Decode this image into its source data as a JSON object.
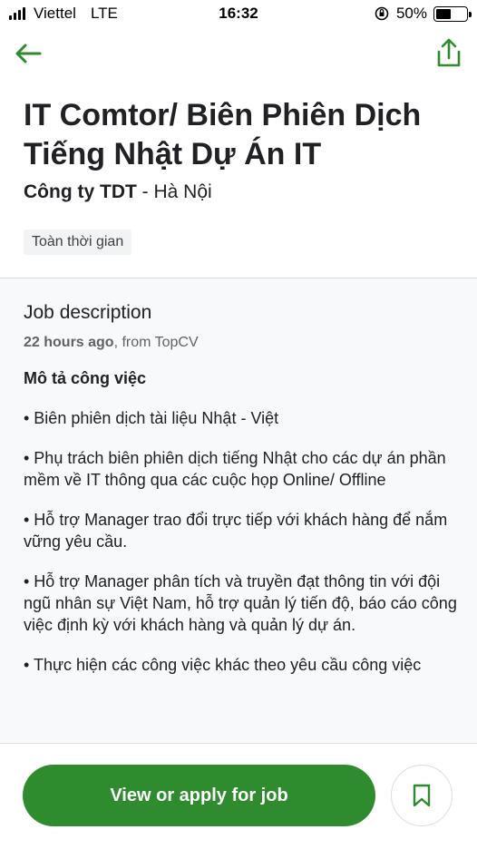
{
  "status_bar": {
    "carrier": "Viettel",
    "network": "LTE",
    "time": "16:32",
    "battery_percent": "50%",
    "battery_level": 0.5,
    "signal_icon": "signal-bars-icon",
    "orientation_lock_icon": "orientation-lock-icon"
  },
  "nav": {
    "back_icon": "arrow-left-icon",
    "share_icon": "share-icon",
    "icon_color": "#2e8b2e"
  },
  "job": {
    "title": "IT Comtor/ Biên Phiên Dịch Tiếng Nhật Dự Án IT",
    "company": "Công ty TDT",
    "separator": " - ",
    "location": "Hà Nội",
    "employment_type": "Toàn thời gian"
  },
  "description": {
    "heading": "Job description",
    "posted": "22 hours ago",
    "source": ", from TopCV",
    "subheading": "Mô tả công việc",
    "bullets": [
      "• Biên phiên dịch tài liệu Nhật - Việt",
      "• Phụ trách biên phiên dịch tiếng Nhật cho các dự án phần mềm về IT thông qua các cuộc họp Online/ Offline",
      "• Hỗ trợ Manager trao đổi trực tiếp với khách hàng để nắm vững yêu cầu.",
      "• Hỗ trợ Manager phân tích và truyền đạt thông tin với đội ngũ nhân sự Việt Nam, hỗ trợ quản lý tiến độ, báo cáo công việc định kỳ với khách hàng và quản lý dự án.",
      "• Thực hiện các công việc khác theo yêu cầu công việc"
    ]
  },
  "actions": {
    "apply_label": "View or apply for job",
    "bookmark_icon": "bookmark-icon",
    "accent_color": "#2e8b2e"
  }
}
